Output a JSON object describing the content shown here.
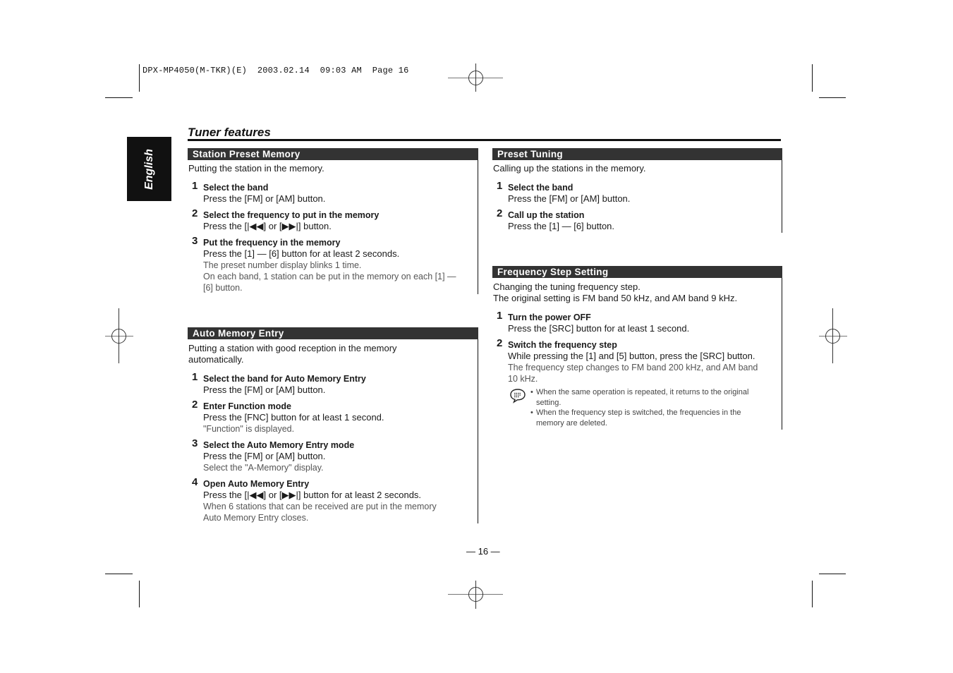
{
  "print_header": {
    "job": "DPX-MP4050(M-TKR)(E)",
    "date": "2003.02.14",
    "time": "09:03 AM",
    "page_label": "Page 16"
  },
  "language_tab": "English",
  "page_title": "Tuner features",
  "sections": {
    "station_preset_memory": {
      "heading": "Station Preset Memory",
      "intro": "Putting the station in the memory.",
      "steps": [
        {
          "num": "1",
          "title": "Select the band",
          "lines": [
            "Press the [FM] or [AM] button."
          ],
          "notes": []
        },
        {
          "num": "2",
          "title": "Select the frequency to put in the memory",
          "lines": [
            "Press the [|◀◀] or [▶▶|] button."
          ],
          "notes": []
        },
        {
          "num": "3",
          "title": "Put the frequency in the memory",
          "lines": [
            "Press the [1] — [6] button for at least 2 seconds."
          ],
          "notes": [
            "The preset number display blinks 1 time.",
            "On each band, 1 station can be put in the memory on each [1] —",
            "[6] button."
          ]
        }
      ]
    },
    "auto_memory_entry": {
      "heading": "Auto Memory Entry",
      "intro_lines": [
        "Putting a station with good reception in the memory",
        "automatically."
      ],
      "steps": [
        {
          "num": "1",
          "title": "Select the band for Auto Memory Entry",
          "lines": [
            "Press the [FM] or [AM] button."
          ],
          "notes": []
        },
        {
          "num": "2",
          "title": "Enter Function mode",
          "lines": [
            "Press the [FNC] button for at least 1 second."
          ],
          "notes": [
            "\"Function\" is displayed."
          ]
        },
        {
          "num": "3",
          "title": "Select the Auto Memory Entry mode",
          "lines": [
            "Press the [FM] or [AM] button."
          ],
          "notes": [
            "Select the \"A-Memory\" display."
          ]
        },
        {
          "num": "4",
          "title": "Open Auto Memory Entry",
          "lines": [
            "Press the [|◀◀] or [▶▶|] button for at least 2 seconds."
          ],
          "notes": [
            "When 6 stations that can be received are put in the memory",
            "Auto Memory Entry closes."
          ]
        }
      ]
    },
    "preset_tuning": {
      "heading": "Preset Tuning",
      "intro": "Calling up the stations in the memory.",
      "steps": [
        {
          "num": "1",
          "title": "Select the band",
          "lines": [
            "Press the [FM] or [AM] button."
          ],
          "notes": []
        },
        {
          "num": "2",
          "title": "Call up the station",
          "lines": [
            "Press the [1] — [6] button."
          ],
          "notes": []
        }
      ]
    },
    "frequency_step_setting": {
      "heading": "Frequency Step Setting",
      "intro_lines": [
        "Changing the tuning frequency step.",
        "The original setting is FM band 50 kHz, and AM band 9 kHz."
      ],
      "steps": [
        {
          "num": "1",
          "title": "Turn the power OFF",
          "lines": [
            "Press the [SRC] button for at least 1 second."
          ],
          "notes": []
        },
        {
          "num": "2",
          "title": "Switch the frequency step",
          "lines": [
            "While pressing the [1] and [5] button, press the [SRC] button."
          ],
          "notes": [
            "The frequency step changes to FM band 200 kHz, and AM band",
            "10 kHz."
          ]
        }
      ],
      "tips": [
        [
          "When the same operation is repeated, it returns to the original",
          "setting."
        ],
        [
          "When the frequency step is switched, the frequencies in the",
          "memory are deleted."
        ]
      ],
      "tip_icon": "note-speech-bubble-icon"
    }
  },
  "page_number": "— 16 —"
}
